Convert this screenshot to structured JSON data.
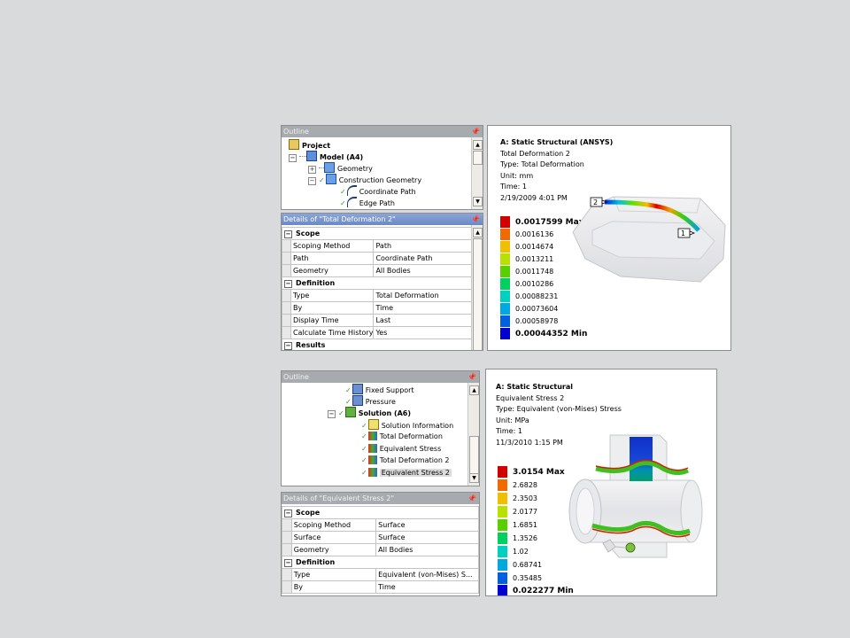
{
  "top": {
    "outline": {
      "title": "Outline",
      "items": [
        {
          "label": "Project",
          "bold": true
        },
        {
          "label": "Model (A4)",
          "bold": true
        },
        {
          "label": "Geometry"
        },
        {
          "label": "Construction Geometry"
        },
        {
          "label": "Coordinate Path"
        },
        {
          "label": "Edge Path"
        }
      ]
    },
    "details": {
      "title": "Details of \"Total Deformation 2\"",
      "sections": [
        {
          "name": "Scope",
          "rows": [
            {
              "k": "Scoping Method",
              "v": "Path"
            },
            {
              "k": "Path",
              "v": "Coordinate Path"
            },
            {
              "k": "Geometry",
              "v": "All Bodies"
            }
          ]
        },
        {
          "name": "Definition",
          "rows": [
            {
              "k": "Type",
              "v": "Total Deformation"
            },
            {
              "k": "By",
              "v": "Time"
            },
            {
              "k": "Display Time",
              "v": "Last"
            },
            {
              "k": "Calculate Time History",
              "v": "Yes"
            }
          ]
        },
        {
          "name": "Results",
          "rows": []
        }
      ]
    },
    "viewport": {
      "title": "A: Static Structural (ANSYS)",
      "lines": [
        "Total Deformation 2",
        "Type: Total Deformation",
        "Unit: mm",
        "Time: 1",
        "2/19/2009 4:01 PM"
      ],
      "legend": [
        "0.0017599 Max",
        "0.0016136",
        "0.0014674",
        "0.0013211",
        "0.0011748",
        "0.0010286",
        "0.00088231",
        "0.00073604",
        "0.00058978",
        "0.00044352 Min"
      ],
      "markers": [
        "2",
        "1"
      ]
    }
  },
  "bottom": {
    "outline": {
      "title": "Outline",
      "items": [
        {
          "label": "Fixed Support"
        },
        {
          "label": "Pressure"
        },
        {
          "label": "Solution (A6)",
          "bold": true
        },
        {
          "label": "Solution Information"
        },
        {
          "label": "Total Deformation"
        },
        {
          "label": "Equivalent Stress"
        },
        {
          "label": "Total Deformation 2"
        },
        {
          "label": "Equivalent Stress 2"
        }
      ]
    },
    "details": {
      "title": "Details of \"Equivalent Stress 2\"",
      "sections": [
        {
          "name": "Scope",
          "rows": [
            {
              "k": "Scoping Method",
              "v": "Surface"
            },
            {
              "k": "Surface",
              "v": "Surface"
            },
            {
              "k": "Geometry",
              "v": "All Bodies"
            }
          ]
        },
        {
          "name": "Definition",
          "rows": [
            {
              "k": "Type",
              "v": "Equivalent (von-Mises) S..."
            },
            {
              "k": "By",
              "v": "Time"
            }
          ]
        }
      ]
    },
    "viewport": {
      "title": "A: Static Structural",
      "lines": [
        "Equivalent Stress 2",
        "Type: Equivalent (von-Mises) Stress",
        "Unit: MPa",
        "Time: 1",
        "11/3/2010 1:15 PM"
      ],
      "legend": [
        "3.0154 Max",
        "2.6828",
        "2.3503",
        "2.0177",
        "1.6851",
        "1.3526",
        "1.02",
        "0.68741",
        "0.35485",
        "0.022277 Min"
      ]
    }
  },
  "legend_colors": [
    "#d40000",
    "#f06a00",
    "#f0c000",
    "#b8e000",
    "#58d000",
    "#00d060",
    "#00d0c0",
    "#00a8e0",
    "#0060e0",
    "#0000d0"
  ]
}
